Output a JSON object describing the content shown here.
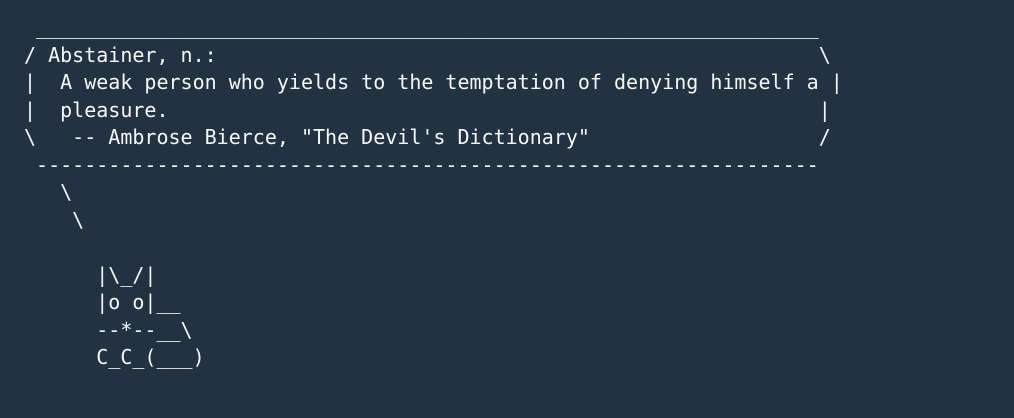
{
  "terminal": {
    "lines": [
      " _________________________________________________________________",
      "/ Abstainer, n.:                                                  \\",
      "|  A weak person who yields to the temptation of denying himself a |",
      "|  pleasure.                                                      |",
      "\\   -- Ambrose Bierce, \"The Devil's Dictionary\"                   /",
      " -----------------------------------------------------------------",
      "   \\",
      "    \\",
      "",
      "      |\\_/|",
      "      |o o|__",
      "      --*--__\\",
      "      C_C_(___)"
    ]
  }
}
